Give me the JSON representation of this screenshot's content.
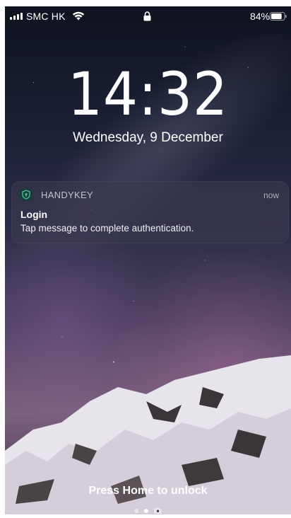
{
  "status_bar": {
    "carrier": "SMC HK",
    "battery_percent": "84%",
    "battery_level": 0.84,
    "icons": [
      "signal-icon",
      "wifi-icon",
      "lock-icon",
      "battery-icon"
    ]
  },
  "lock_screen": {
    "time": "14:32",
    "date": "Wednesday, 9 December"
  },
  "notification": {
    "app_name": "HANDYKEY",
    "time": "now",
    "title": "Login",
    "body": "Tap message to complete authentication.",
    "icon": "shield-icon",
    "accent_color": "#3fbf8f"
  },
  "bottom": {
    "unlock_hint": "Press Home to unlock",
    "pages": 2,
    "active_page": 1,
    "icons": [
      "camera-icon"
    ]
  }
}
